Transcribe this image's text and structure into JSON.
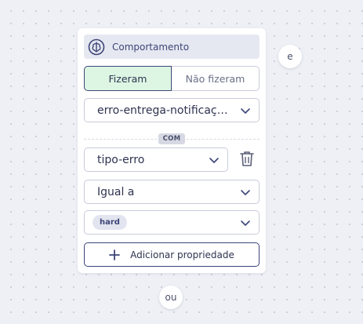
{
  "card": {
    "header": {
      "title": "Comportamento",
      "icon": "brain-icon"
    },
    "toggle": {
      "active": "Fizeram",
      "inactive": "Não fizeram"
    },
    "event_select": {
      "value": "erro-entrega-notificação"
    },
    "connector": {
      "label": "COM"
    },
    "property_select": {
      "value": "tipo-erro"
    },
    "operator_select": {
      "value": "Igual a"
    },
    "value_select": {
      "chips": [
        "hard"
      ]
    },
    "add_button": {
      "label": "Adicionar propriedade"
    }
  },
  "and_connector": {
    "label": "e"
  },
  "or_connector": {
    "label": "ou"
  },
  "colors": {
    "accent": "#3d4577",
    "active_bg": "#dcf6e3",
    "header_bg": "#e6e8f1",
    "canvas_bg": "#eef0f5"
  }
}
